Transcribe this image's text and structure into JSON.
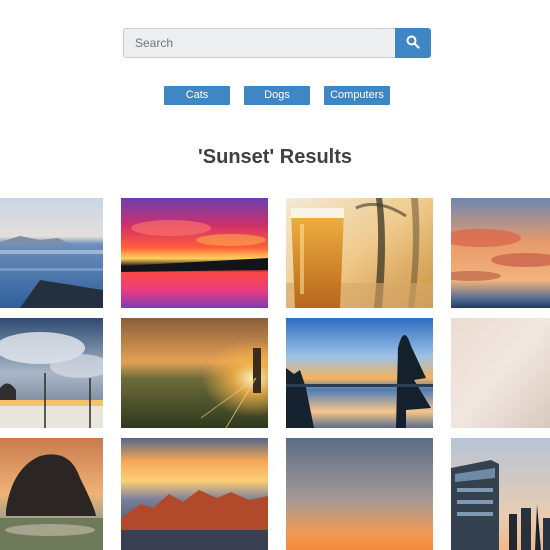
{
  "search": {
    "placeholder": "Search",
    "value": "",
    "button_icon": "search-icon"
  },
  "categories": [
    {
      "label": "Cats"
    },
    {
      "label": "Dogs"
    },
    {
      "label": "Computers"
    }
  ],
  "results": {
    "title": "'Sunset' Results"
  },
  "colors": {
    "accent": "#3f87c4",
    "title_text": "#3c4148",
    "search_bg": "#eceef0"
  }
}
